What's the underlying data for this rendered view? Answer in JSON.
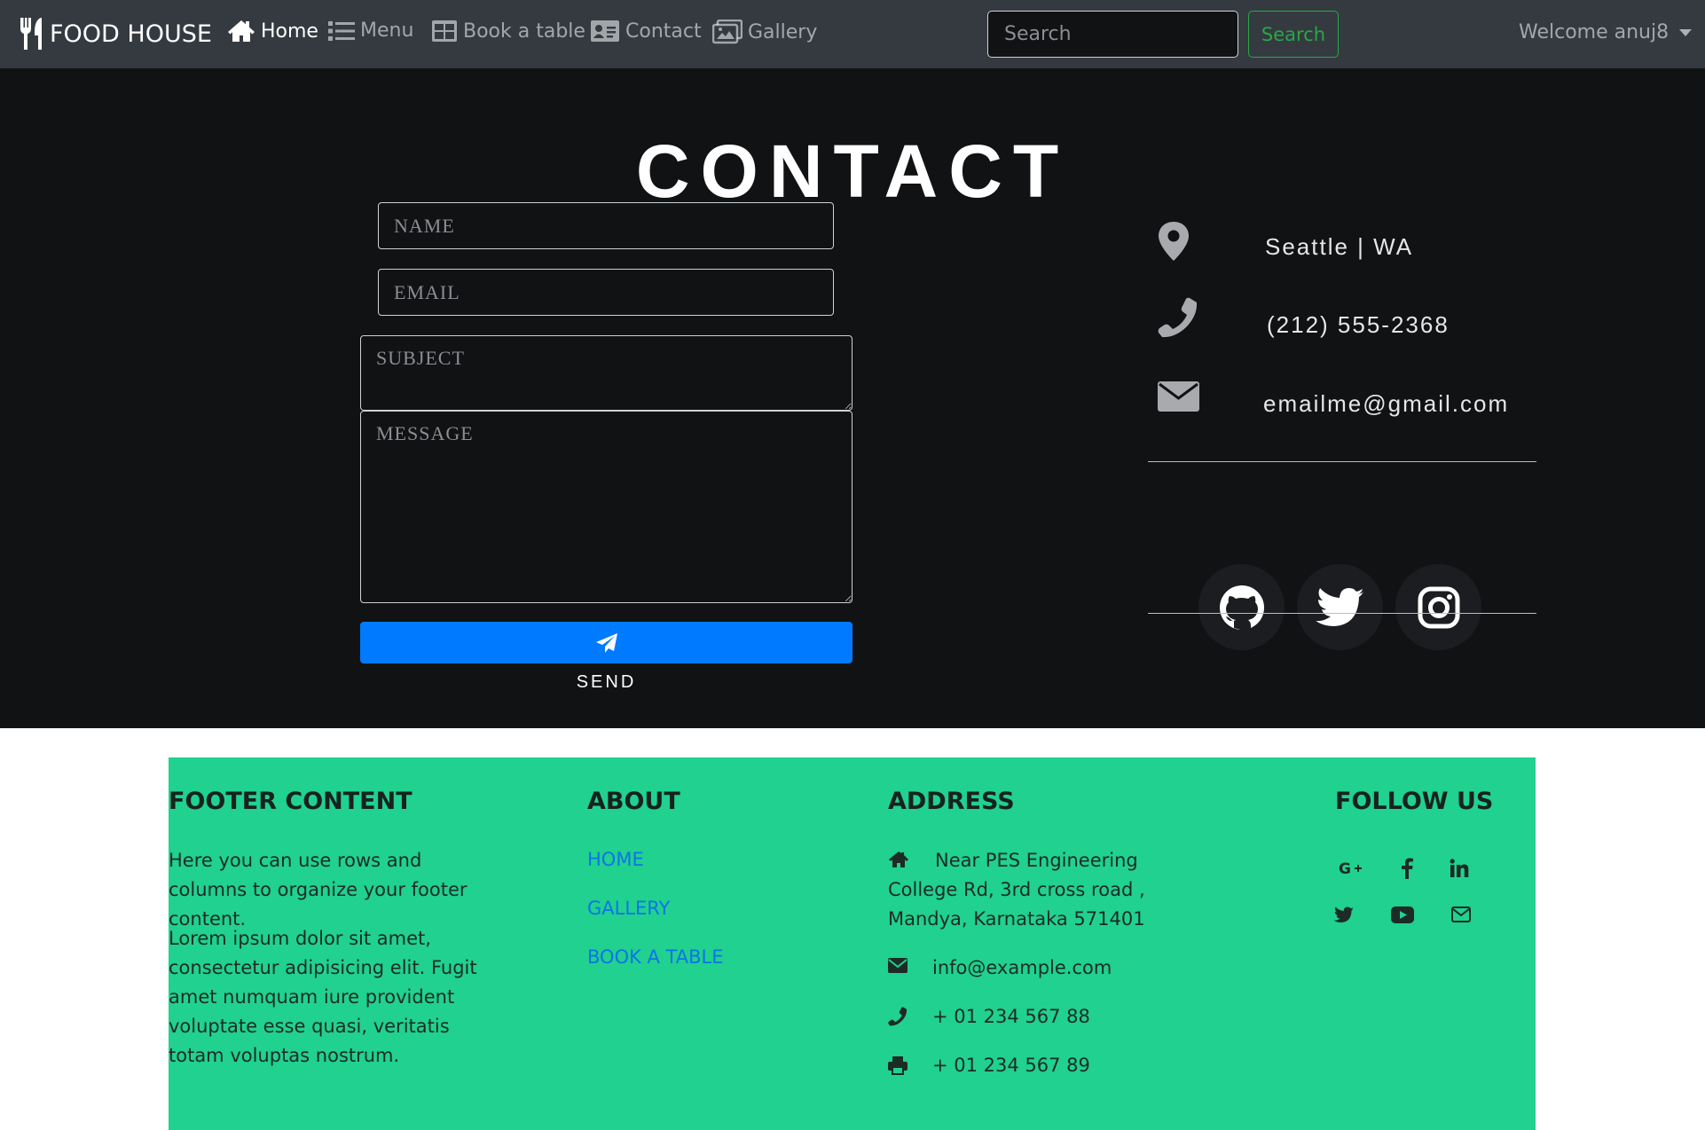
{
  "navbar": {
    "brand": "FOOD HOUSE",
    "links": [
      {
        "label": "Home",
        "icon": "home-icon",
        "active": true
      },
      {
        "label": "Menu",
        "icon": "list-icon",
        "active": false
      },
      {
        "label": "Book a table",
        "icon": "table-icon",
        "active": false
      },
      {
        "label": "Contact",
        "icon": "id-card-icon",
        "active": false
      },
      {
        "label": "Gallery",
        "icon": "images-icon",
        "active": false
      }
    ],
    "search": {
      "placeholder": "Search",
      "value": "",
      "button": "Search"
    },
    "welcome": "Welcome anuj8"
  },
  "contact": {
    "title": "CONTACT",
    "form": {
      "name_placeholder": "NAME",
      "email_placeholder": "EMAIL",
      "subject_placeholder": "SUBJECT",
      "message_placeholder": "MESSAGE",
      "send_label": "SEND"
    },
    "info": {
      "location": "Seattle | WA",
      "phone": "(212) 555-2368",
      "email": "emailme@gmail.com"
    },
    "social": [
      "github-icon",
      "twitter-icon",
      "instagram-icon"
    ]
  },
  "footer": {
    "content": {
      "heading": "FOOTER CONTENT",
      "p1": "Here you can use rows and columns to organize your footer content.",
      "p2": "Lorem ipsum dolor sit amet, consectetur adipisicing elit. Fugit amet numquam iure provident voluptate esse quasi, veritatis totam voluptas nostrum."
    },
    "about": {
      "heading": "ABOUT",
      "links": [
        "HOME",
        "GALLERY",
        "BOOK A TABLE"
      ]
    },
    "address": {
      "heading": "ADDRESS",
      "street": "Near PES Engineering College Rd, 3rd cross road , Mandya, Karnataka 571401",
      "email": "info@example.com",
      "phone": "+ 01 234 567 88",
      "fax": "+ 01 234 567 89"
    },
    "follow": {
      "heading": "FOLLOW US",
      "icons": [
        "google-plus-icon",
        "facebook-icon",
        "linkedin-icon",
        "twitter-icon",
        "youtube-icon",
        "envelope-icon"
      ]
    }
  },
  "colors": {
    "navbar_bg": "#343a40",
    "contact_bg": "#111214",
    "send_button": "#007bff",
    "footer_bg": "#20d18f",
    "search_button": "#28a745",
    "footer_link": "#0d74e8"
  }
}
